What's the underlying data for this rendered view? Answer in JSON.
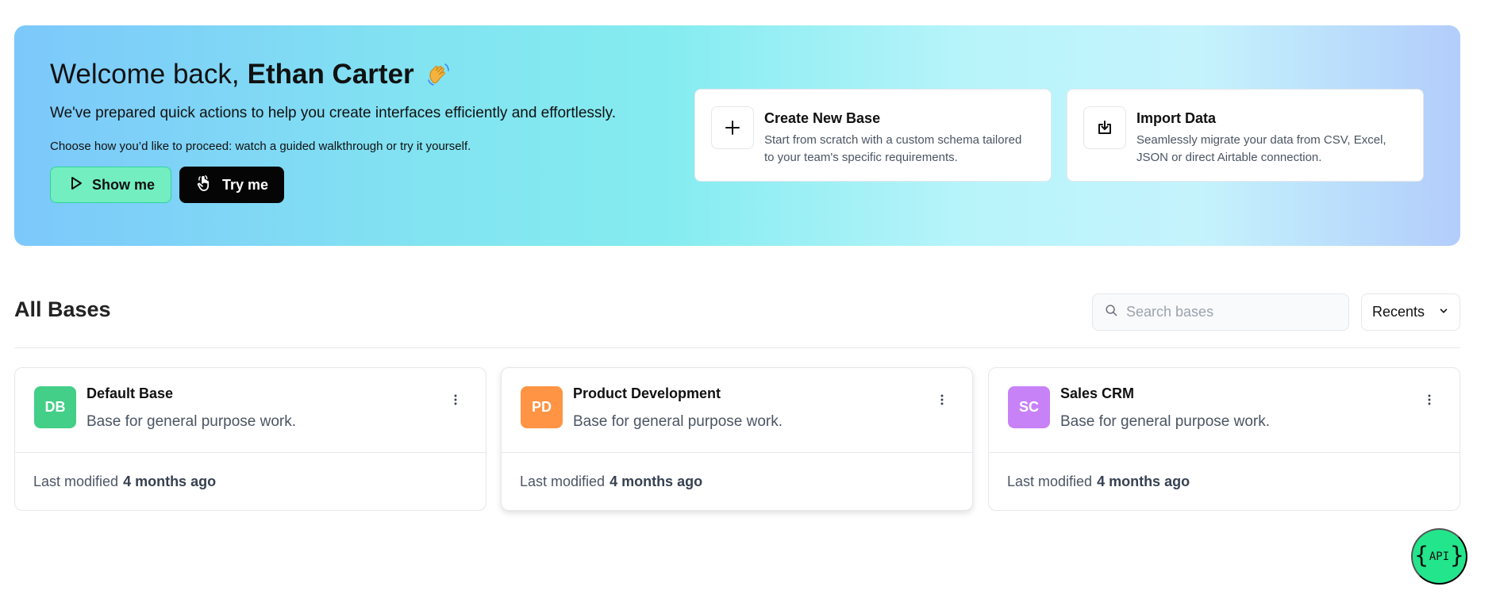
{
  "hero": {
    "title_prefix": "Welcome back,",
    "user_name": "Ethan Carter",
    "subtitle": "We've prepared quick actions to help you create interfaces efficiently and effortlessly.",
    "helper": "Choose how you’d like to proceed: watch a guided walkthrough or try it yourself.",
    "show_label": "Show me",
    "try_label": "Try me",
    "icons": {
      "wave": "waving-hand-icon",
      "show": "play-icon",
      "try": "pointer-hand-icon"
    }
  },
  "actions": [
    {
      "title": "Create New Base",
      "description": "Start from scratch with a custom schema tailored to your team's specific requirements.",
      "icon": "plus-icon"
    },
    {
      "title": "Import Data",
      "description": "Seamlessly migrate your data from CSV, Excel, JSON or direct Airtable connection.",
      "icon": "import-icon"
    }
  ],
  "bases_section": {
    "title": "All Bases",
    "search_placeholder": "Search bases",
    "sort_value": "Recents",
    "last_modified_prefix": "Last modified"
  },
  "bases": [
    {
      "initials": "DB",
      "name": "Default Base",
      "description": "Base for general purpose work.",
      "modified": "4 months ago",
      "color": "#43cf88"
    },
    {
      "initials": "PD",
      "name": "Product Development",
      "description": "Base for general purpose work.",
      "modified": "4 months ago",
      "color": "#ff9444"
    },
    {
      "initials": "SC",
      "name": "Sales CRM",
      "description": "Base for general purpose work.",
      "modified": "4 months ago",
      "color": "#c882f8"
    }
  ],
  "api_button": {
    "label": "API",
    "color": "#23e58b"
  }
}
